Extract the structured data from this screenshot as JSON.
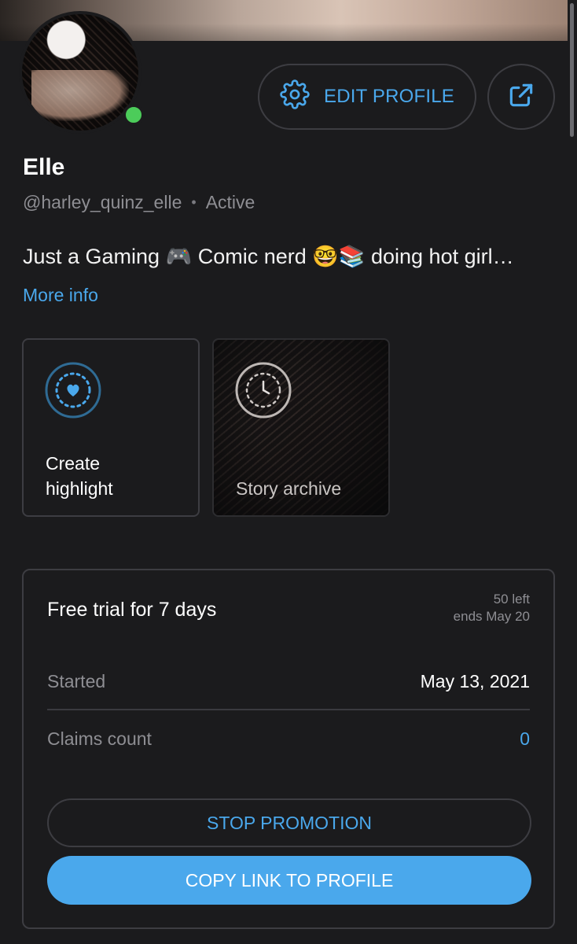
{
  "profile": {
    "name": "Elle",
    "handle": "@harley_quinz_elle",
    "status": "Active",
    "bio": "Just a Gaming 🎮 Comic nerd 🤓📚 doing hot girl…",
    "more_info": "More info",
    "edit_label": "EDIT PROFILE"
  },
  "highlights": {
    "create_line1": "Create",
    "create_line2": "highlight",
    "archive_label": "Story archive"
  },
  "promotion": {
    "title": "Free trial for 7 days",
    "remaining": "50 left",
    "ends": "ends May 20",
    "started_label": "Started",
    "started_value": "May 13, 2021",
    "claims_label": "Claims count",
    "claims_value": "0",
    "stop_label": "STOP PROMOTION",
    "copy_label": "COPY LINK TO PROFILE"
  },
  "icons": {
    "settings": "gear-icon",
    "share": "share-icon",
    "highlight": "heart-ring-icon",
    "archive": "clock-ring-icon"
  },
  "colors": {
    "background": "#1b1b1d",
    "accent": "#4aa8ec",
    "online": "#4ccc5a",
    "muted_text": "#8e8e93",
    "border": "#3d3d42"
  }
}
